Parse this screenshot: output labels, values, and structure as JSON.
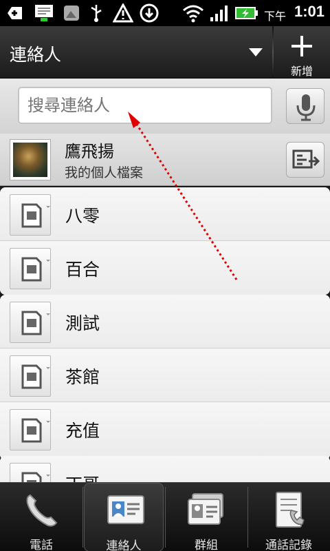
{
  "status_bar": {
    "ampm": "下午",
    "time": "1:01",
    "icons": [
      "add-icon",
      "notification-icon",
      "image-icon",
      "usb-icon",
      "warning-icon",
      "download-icon",
      "wifi-icon",
      "signal-icon",
      "battery-charging-icon"
    ]
  },
  "title_bar": {
    "title": "連絡人",
    "add_label": "新增"
  },
  "search": {
    "placeholder": "搜尋連絡人"
  },
  "profile": {
    "name": "鷹飛揚",
    "subtitle": "我的個人檔案"
  },
  "contacts": [
    {
      "name": "八零"
    },
    {
      "name": "百合"
    },
    {
      "name": "測試"
    },
    {
      "name": "茶館"
    },
    {
      "name": "充值"
    },
    {
      "name": "丁哥"
    }
  ],
  "tabs": [
    {
      "label": "電話",
      "icon": "phone-icon"
    },
    {
      "label": "連絡人",
      "icon": "contacts-icon"
    },
    {
      "label": "群組",
      "icon": "groups-icon"
    },
    {
      "label": "通話記錄",
      "icon": "call-log-icon"
    }
  ],
  "colors": {
    "annotation_arrow": "#e00000",
    "title_bar": "#2a2a2a",
    "list_bg": "#f2f2f2"
  }
}
